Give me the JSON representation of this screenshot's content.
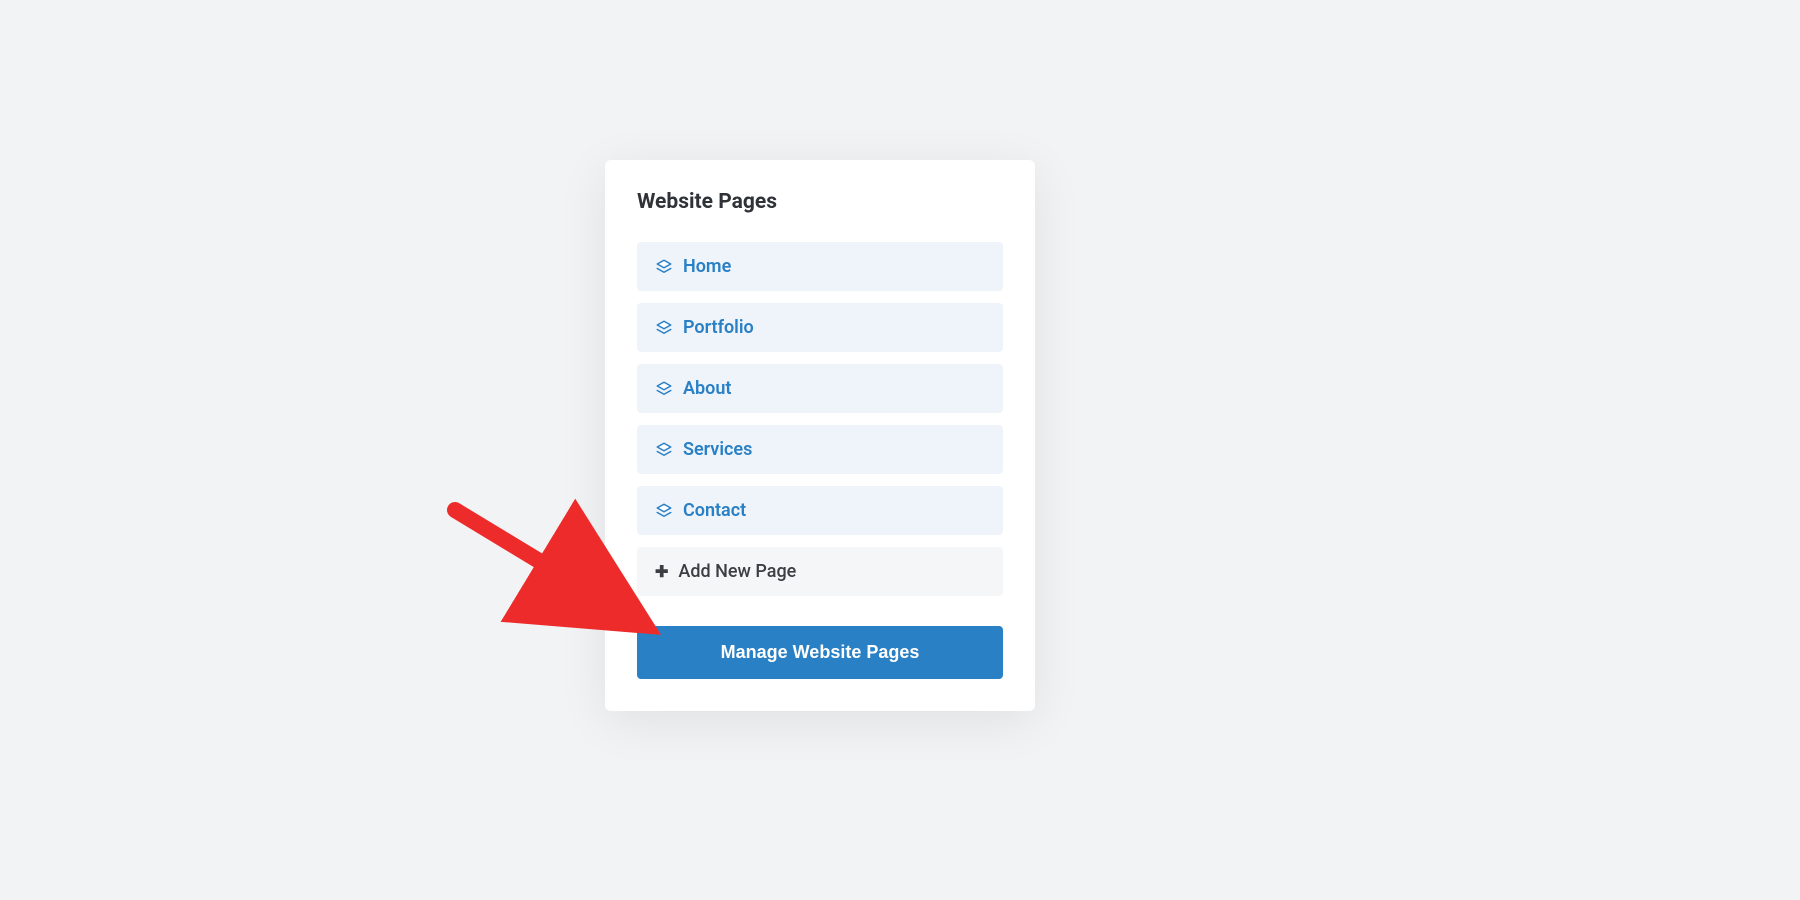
{
  "card": {
    "title": "Website Pages",
    "pages": [
      {
        "label": "Home"
      },
      {
        "label": "Portfolio"
      },
      {
        "label": "About"
      },
      {
        "label": "Services"
      },
      {
        "label": "Contact"
      }
    ],
    "add_label": "Add New Page",
    "manage_button_label": "Manage Website Pages"
  },
  "annotation": {
    "arrow_color": "#ee2b2b"
  }
}
